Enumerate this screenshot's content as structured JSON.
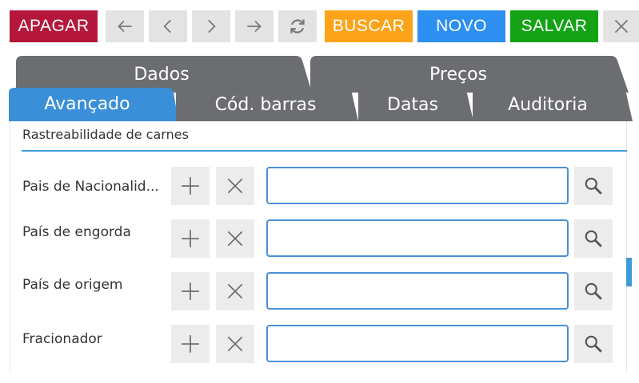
{
  "toolbar": {
    "apagar": "APAGAR",
    "buscar": "BUSCAR",
    "novo": "NOVO",
    "salvar": "SALVAR"
  },
  "colors": {
    "apagar": "#b5173a",
    "buscar": "#fca319",
    "novo": "#2d8ff0",
    "salvar": "#13a315",
    "tab_dark": "#6b6d70",
    "tab_active": "#3a8fd8",
    "accent": "#3d9bd7"
  },
  "tabs_top": [
    "Dados",
    "Preços"
  ],
  "tabs_bottom": [
    "Avançado",
    "Cód. barras",
    "Datas",
    "Auditoria"
  ],
  "section": {
    "title": "Rastreabilidade de carnes"
  },
  "rows": [
    {
      "label": "Pais de Nacionalid...",
      "value": ""
    },
    {
      "label": "País de engorda",
      "value": ""
    },
    {
      "label": "País de origem",
      "value": ""
    },
    {
      "label": "Fracionador",
      "value": ""
    }
  ],
  "icons": {
    "back": "arrow-left-icon",
    "prev": "chevron-left-icon",
    "next": "chevron-right-icon",
    "forward": "arrow-right-icon",
    "refresh": "refresh-icon",
    "close": "close-icon",
    "add": "plus-icon",
    "clear": "x-icon",
    "search": "search-icon"
  }
}
